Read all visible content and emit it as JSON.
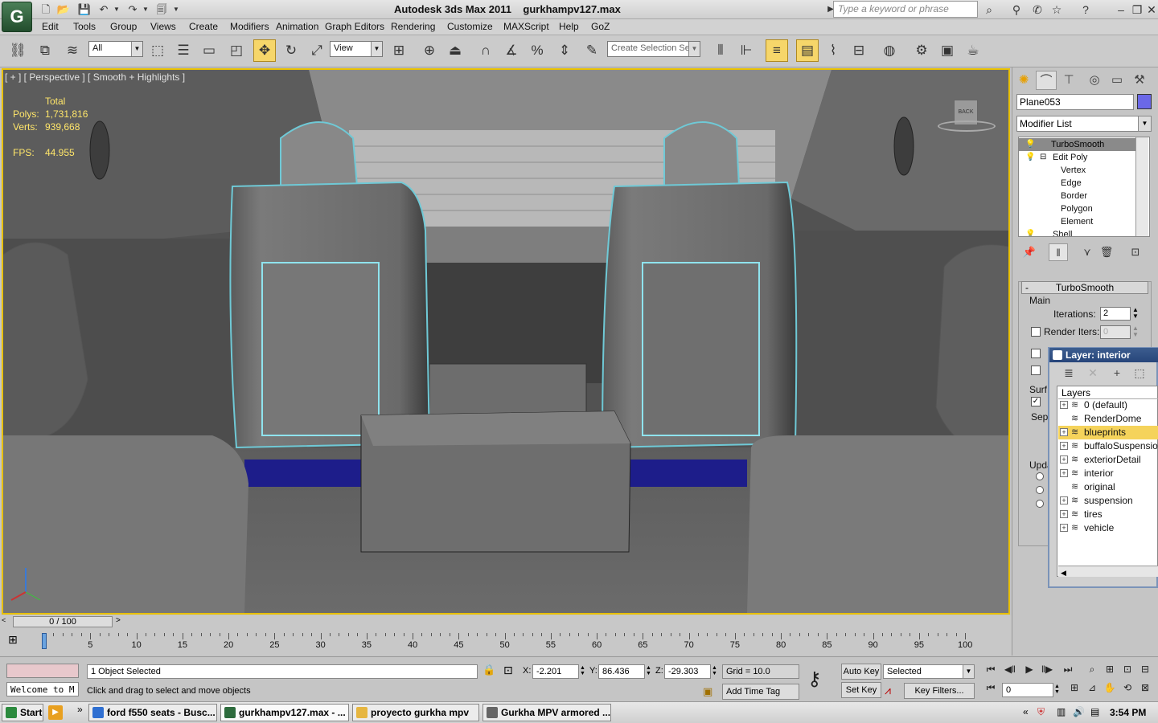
{
  "window": {
    "app_title": "Autodesk 3ds Max  2011",
    "file_name": "gurkhampv127.max",
    "search_placeholder": "Type a keyword or phrase"
  },
  "menu": [
    "Edit",
    "Tools",
    "Group",
    "Views",
    "Create",
    "Modifiers",
    "Animation",
    "Graph Editors",
    "Rendering",
    "Customize",
    "MAXScript",
    "Help",
    "GoZ"
  ],
  "toolbar": {
    "filter_value": "All",
    "refcoord_value": "View",
    "selection_set_placeholder": "Create Selection Se"
  },
  "viewport": {
    "label": "[ + ] [ Perspective ] [ Smooth + Highlights ]",
    "stats": {
      "header": "Total",
      "polys_label": "Polys:",
      "polys_value": "1,731,816",
      "verts_label": "Verts:",
      "verts_value": "939,668",
      "fps_label": "FPS:",
      "fps_value": "44.955"
    },
    "viewcube_label": "BACK"
  },
  "command_panel": {
    "object_name": "Plane053",
    "object_color": "#6b68e8",
    "modifier_list_label": "Modifier List",
    "stack": [
      {
        "label": "TurboSmooth",
        "selected": true,
        "indent": 0
      },
      {
        "label": "Edit Poly",
        "selected": false,
        "indent": 1
      },
      {
        "label": "Vertex",
        "selected": false,
        "indent": 2
      },
      {
        "label": "Edge",
        "selected": false,
        "indent": 2
      },
      {
        "label": "Border",
        "selected": false,
        "indent": 2
      },
      {
        "label": "Polygon",
        "selected": false,
        "indent": 2
      },
      {
        "label": "Element",
        "selected": false,
        "indent": 2
      },
      {
        "label": "Shell",
        "selected": false,
        "indent": 0
      }
    ],
    "rollout": {
      "title": "TurboSmooth",
      "group_main": "Main",
      "iterations_label": "Iterations:",
      "iterations_value": "2",
      "render_iters_label": "Render Iters:",
      "render_iters_value": "0",
      "surface_label": "Surf",
      "sep_label": "Sep",
      "update_label": "Upda"
    }
  },
  "layer_window": {
    "title": "Layer: interior",
    "header": "Layers",
    "layers": [
      {
        "name": "0 (default)",
        "expand": true,
        "selected": false
      },
      {
        "name": "RenderDome",
        "expand": false,
        "selected": false
      },
      {
        "name": "blueprints",
        "expand": true,
        "selected": true
      },
      {
        "name": "buffaloSuspension",
        "expand": true,
        "selected": false
      },
      {
        "name": "exteriorDetail",
        "expand": true,
        "selected": false
      },
      {
        "name": "interior",
        "expand": true,
        "selected": false
      },
      {
        "name": "original",
        "expand": false,
        "selected": false
      },
      {
        "name": "suspension",
        "expand": true,
        "selected": false
      },
      {
        "name": "tires",
        "expand": true,
        "selected": false
      },
      {
        "name": "vehicle",
        "expand": true,
        "selected": false
      }
    ]
  },
  "timeline": {
    "slider": "0 / 100",
    "ticks": [
      "0",
      "5",
      "10",
      "15",
      "20",
      "25",
      "30",
      "35",
      "40",
      "45",
      "50",
      "55",
      "60",
      "65",
      "70",
      "75",
      "80",
      "85",
      "90",
      "95",
      "100"
    ]
  },
  "status": {
    "selected_text": "1 Object Selected",
    "prompt": "Click and drag to select and move objects",
    "listener": "Welcome to M",
    "x_label": "X:",
    "x_value": "-2.201",
    "y_label": "Y:",
    "y_value": "86.436",
    "z_label": "Z:",
    "z_value": "-29.303",
    "grid": "Grid = 10.0",
    "add_time_tag": "Add Time Tag",
    "auto_key": "Auto Key",
    "set_key": "Set Key",
    "key_mode": "Selected",
    "key_filters": "Key Filters...",
    "frame": "0"
  },
  "taskbar": {
    "start": "Start",
    "tasks": [
      {
        "label": "ford f550 seats - Busc...",
        "color": "#2f6fd1"
      },
      {
        "label": "gurkhampv127.max - ...",
        "color": "#2d6b3d"
      },
      {
        "label": "proyecto gurkha mpv",
        "color": "#e6b640"
      },
      {
        "label": "Gurkha MPV armored ...",
        "color": "#666666"
      }
    ],
    "clock": "3:54 PM"
  }
}
